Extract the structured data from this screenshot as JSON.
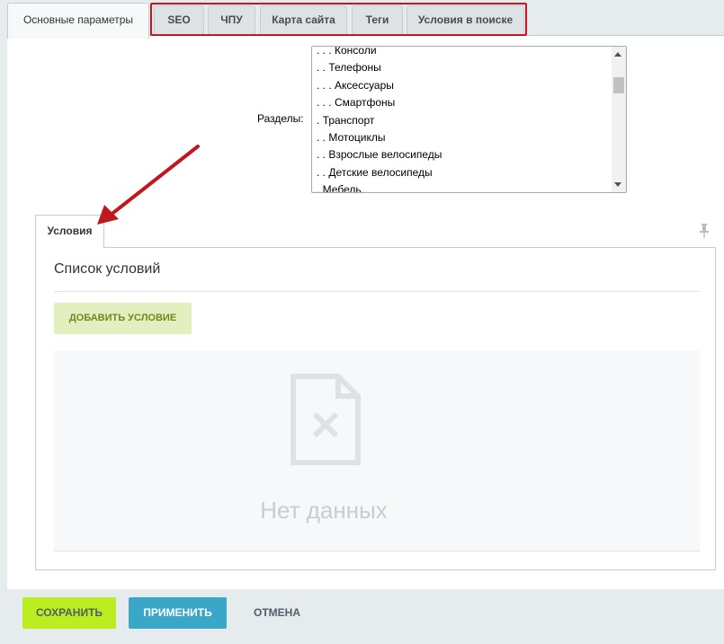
{
  "tabs": [
    {
      "label": "Основные параметры",
      "active": true
    },
    {
      "label": "SEO"
    },
    {
      "label": "ЧПУ"
    },
    {
      "label": "Карта сайта"
    },
    {
      "label": "Теги"
    },
    {
      "label": "Условия в поиске"
    }
  ],
  "sections": {
    "label": "Разделы:",
    "options": [
      ". . . Консоли",
      ". . Телефоны",
      ". . . Аксессуары",
      ". . . Смартфоны",
      ". Транспорт",
      ". . Мотоциклы",
      ". . Взрослые велосипеды",
      ". . Детские велосипеды",
      ". Мебель"
    ]
  },
  "conditions": {
    "tab_label": "Условия",
    "list_title": "Список условий",
    "add_button": "ДОБАВИТЬ УСЛОВИЕ",
    "empty_text": "Нет данных"
  },
  "footer": {
    "save": "СОХРАНИТЬ",
    "apply": "ПРИМЕНИТЬ",
    "cancel": "ОТМЕНА"
  },
  "colors": {
    "highlight_border": "#c9161c",
    "annotation_arrow": "#c0181e",
    "save_button": "#bbed21",
    "apply_button": "#3aa6c8",
    "add_button_bg": "#e3efbf"
  },
  "icons": [
    "pin-icon",
    "empty-file-icon",
    "annotation-arrow"
  ]
}
